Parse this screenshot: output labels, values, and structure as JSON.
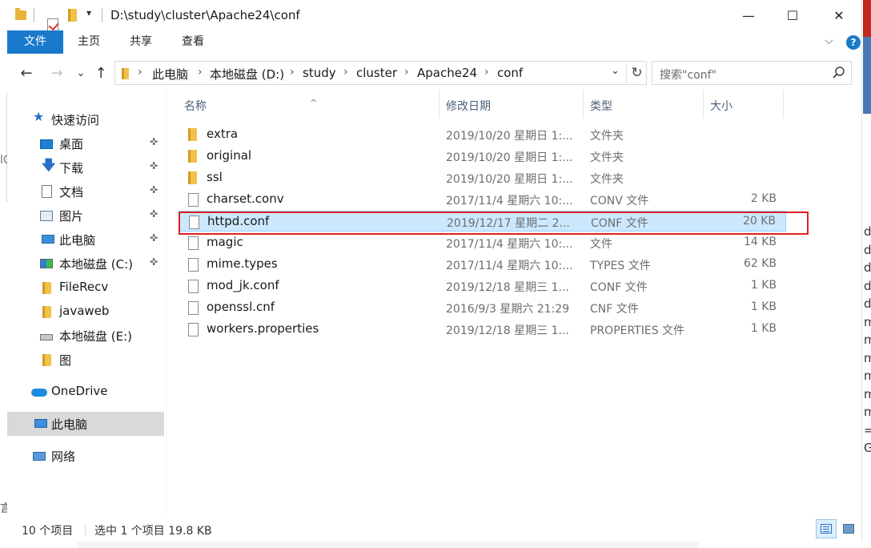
{
  "window": {
    "title": "D:\\study\\cluster\\Apache24\\conf",
    "qa_dropdown_glyph": "▾",
    "minimize_glyph": "—",
    "maximize_glyph": "☐",
    "close_glyph": "✕"
  },
  "ribbon": {
    "tabs": [
      "文件",
      "主页",
      "共享",
      "查看"
    ],
    "active_tab": "文件",
    "collapse_glyph": "⌵",
    "help_glyph": "?"
  },
  "nav": {
    "back_glyph": "←",
    "forward_glyph": "→",
    "recent_glyph": "⌄",
    "up_glyph": "↑"
  },
  "address": {
    "crumbs": [
      "此电脑",
      "本地磁盘 (D:)",
      "study",
      "cluster",
      "Apache24",
      "conf"
    ],
    "separator": "›",
    "dropdown_glyph": "⌄",
    "refresh_glyph": "↻"
  },
  "search": {
    "placeholder": "搜索\"conf\""
  },
  "navpane": {
    "items": [
      {
        "label": "快速访问",
        "icon": "star-icon",
        "pinned": false
      },
      {
        "label": "桌面",
        "icon": "desktop-icon",
        "pinned": true
      },
      {
        "label": "下载",
        "icon": "download-icon",
        "pinned": true
      },
      {
        "label": "文档",
        "icon": "document-icon",
        "pinned": true
      },
      {
        "label": "图片",
        "icon": "picture-icon",
        "pinned": true
      },
      {
        "label": "此电脑",
        "icon": "computer-icon",
        "pinned": true
      },
      {
        "label": "本地磁盘 (C:)",
        "icon": "windows-drive-icon",
        "pinned": true
      },
      {
        "label": "FileRecv",
        "icon": "folder-icon",
        "pinned": false
      },
      {
        "label": "javaweb",
        "icon": "folder-icon",
        "pinned": false
      },
      {
        "label": "本地磁盘 (E:)",
        "icon": "drive-icon",
        "pinned": false
      },
      {
        "label": "图",
        "icon": "folder-icon",
        "pinned": false
      },
      {
        "label": "OneDrive",
        "icon": "cloud-icon",
        "pinned": false
      },
      {
        "label": "此电脑",
        "icon": "computer-icon",
        "pinned": false
      },
      {
        "label": "网络",
        "icon": "network-icon",
        "pinned": false
      }
    ],
    "selected_index": 12,
    "pin_glyph": "📌"
  },
  "list": {
    "columns": [
      "名称",
      "修改日期",
      "类型",
      "大小"
    ],
    "sort_glyph": "^",
    "rows": [
      {
        "name": "extra",
        "date": "2019/10/20 星期日 1:...",
        "type": "文件夹",
        "size": "",
        "kind": "folder"
      },
      {
        "name": "original",
        "date": "2019/10/20 星期日 1:...",
        "type": "文件夹",
        "size": "",
        "kind": "folder"
      },
      {
        "name": "ssl",
        "date": "2019/10/20 星期日 1:...",
        "type": "文件夹",
        "size": "",
        "kind": "folder"
      },
      {
        "name": "charset.conv",
        "date": "2017/11/4 星期六 10:...",
        "type": "CONV 文件",
        "size": "2 KB",
        "kind": "file"
      },
      {
        "name": "httpd.conf",
        "date": "2019/12/17 星期二 2...",
        "type": "CONF 文件",
        "size": "20 KB",
        "kind": "file"
      },
      {
        "name": "magic",
        "date": "2017/11/4 星期六 10:...",
        "type": "文件",
        "size": "14 KB",
        "kind": "file"
      },
      {
        "name": "mime.types",
        "date": "2017/11/4 星期六 10:...",
        "type": "TYPES 文件",
        "size": "62 KB",
        "kind": "file"
      },
      {
        "name": "mod_jk.conf",
        "date": "2019/12/18 星期三 1...",
        "type": "CONF 文件",
        "size": "1 KB",
        "kind": "file"
      },
      {
        "name": "openssl.cnf",
        "date": "2016/9/3 星期六 21:29",
        "type": "CNF 文件",
        "size": "1 KB",
        "kind": "file"
      },
      {
        "name": "workers.properties",
        "date": "2019/12/18 星期三 1...",
        "type": "PROPERTIES 文件",
        "size": "1 KB",
        "kind": "file"
      }
    ],
    "selected_index": 4
  },
  "status": {
    "count": "10 个项目",
    "selection": "选中 1 个项目  19.8 KB"
  },
  "background": {
    "right_glyphs": [
      "d",
      "d",
      "d",
      "d",
      "d",
      "m",
      "m",
      "m",
      "m",
      "m",
      "m",
      "=",
      "G"
    ],
    "left_glyph_top": "lC",
    "left_glyph_bottom": "言"
  },
  "colors": {
    "accent": "#1979ca",
    "selection": "#cce8ff",
    "highlight_box": "#e02020",
    "folder": "#f0c24a"
  }
}
